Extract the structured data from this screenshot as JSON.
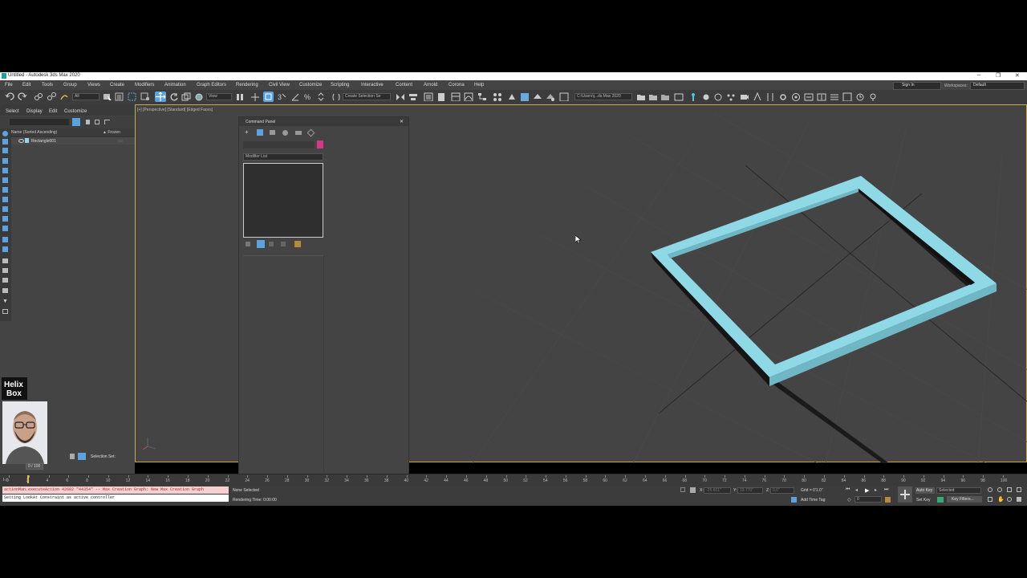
{
  "window": {
    "title": "Untitled - Autodesk 3ds Max 2020",
    "min": "–",
    "max": "❐",
    "close": "✕"
  },
  "menu": [
    "File",
    "Edit",
    "Tools",
    "Group",
    "Views",
    "Create",
    "Modifiers",
    "Animation",
    "Graph Editors",
    "Rendering",
    "Civil View",
    "Customize",
    "Scripting",
    "Interactive",
    "Content",
    "Arnold",
    "Corona",
    "Help"
  ],
  "account": {
    "sign_in": "Sign In",
    "workspaces_label": "Workspaces:",
    "workspace": "Default"
  },
  "toolbar": {
    "filter": "All",
    "refsys": "View",
    "selection_set": "Create Selection Se",
    "path": "C:\\Users\\j...ds Max 2020"
  },
  "scene_explorer": {
    "tabs": [
      "Select",
      "Display",
      "Edit",
      "Customize"
    ],
    "column_name": "Name (Sorted Ascending)",
    "column_frozen": "▲ Frozen",
    "items": [
      {
        "name": "Rectangle001"
      }
    ],
    "selection_set_label": "Selection Set:"
  },
  "viewport_label": "[+] [Perspective] [Standard] [Edged Faces]",
  "command_panel": {
    "title": "Command Panel",
    "close": "✕",
    "modifier_list": "Modifier List",
    "color": "#d4388b"
  },
  "timeline": {
    "frame": "0 / 100",
    "ticks": [
      "0",
      "2",
      "4",
      "6",
      "8",
      "10",
      "12",
      "14",
      "16",
      "18",
      "20",
      "22",
      "24",
      "26",
      "28",
      "30",
      "32",
      "34",
      "36",
      "38",
      "40",
      "42",
      "44",
      "46",
      "48",
      "50",
      "52",
      "54",
      "56",
      "58",
      "60",
      "62",
      "64",
      "66",
      "68",
      "70",
      "72",
      "74",
      "76",
      "78",
      "80",
      "82",
      "84",
      "86",
      "88",
      "90",
      "92",
      "94",
      "96",
      "98",
      "100"
    ]
  },
  "maxscript": {
    "listener": "actionMan.executeAction 42682 \"44354\"  -- Max Creation Graph: New Max Creation Graph",
    "prompt": "Setting LookAt Constraint as active controller"
  },
  "status": {
    "selection": "None Selected",
    "render_time": "Rendering Time: 0:00:00",
    "x_label": "X:",
    "x_value": "-25.601\"",
    "y_label": "Y:",
    "y_value": "33.770\"",
    "z_label": "Z:",
    "z_value": "0.0\"",
    "grid": "Grid = 0'1.0\"",
    "add_time_tag": "Add Time Tag",
    "auto_key": "Auto Key",
    "selected": "Selected",
    "set_key": "Set Key",
    "key_filters": "Key Filters...",
    "frame_value": "0"
  },
  "webcam": {
    "logo_line1": "Helix",
    "logo_line2": "Box"
  },
  "colors": {
    "object": "#8fd8e6",
    "accent": "#5aa3e0",
    "viewport_border": "#c9a94a"
  }
}
